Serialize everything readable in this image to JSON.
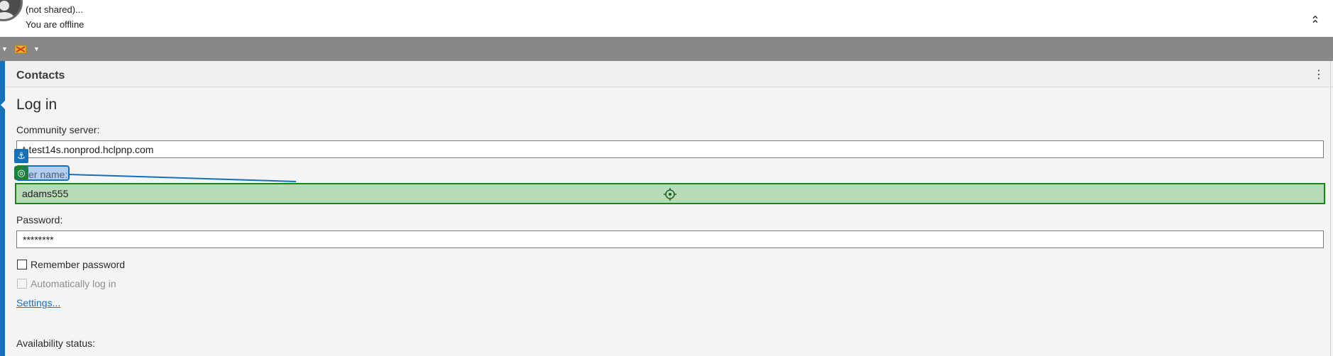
{
  "status": {
    "line1": "(not shared)...",
    "line2": "You are offline"
  },
  "icons": {
    "avatar": "avatar-icon",
    "collapse": "double-chevron-up-icon",
    "status_menu": "status-icon",
    "more": "kebab-icon",
    "anchor": "anchor-icon",
    "target": "target-icon"
  },
  "panel": {
    "title": "Contacts"
  },
  "login": {
    "heading": "Log in",
    "server_label": "Community server:",
    "server_value": "t-test14s.nonprod.hclpnp.com",
    "username_label": "User name:",
    "username_value": "adams555",
    "password_label": "Password:",
    "password_value": "********",
    "remember_label": "Remember password",
    "autologin_label": "Automatically log in",
    "settings_link": "Settings...",
    "availability_label": "Availability status:"
  },
  "colors": {
    "toolbar": "#888888",
    "accent": "#1670b8",
    "highlight_fill": "#b7dbb7",
    "highlight_border": "#138a13"
  }
}
